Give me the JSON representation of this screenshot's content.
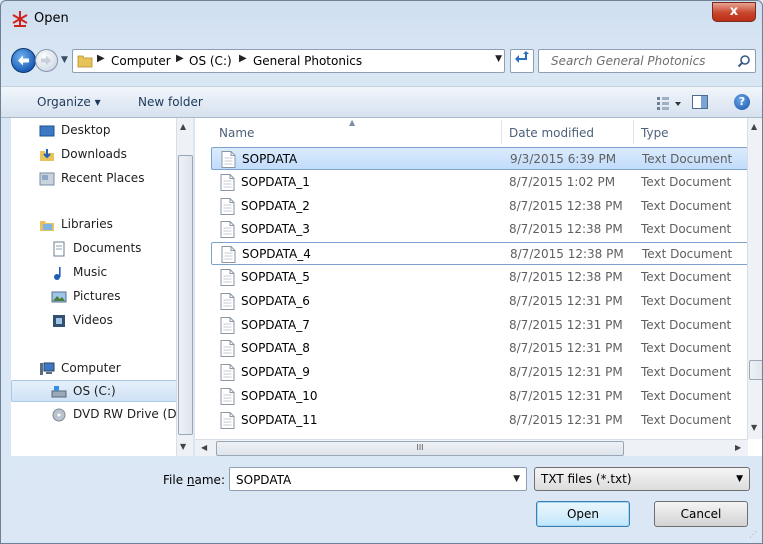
{
  "window": {
    "title": "Open",
    "close_label": "x"
  },
  "address": {
    "crumbs": [
      "Computer",
      "OS (C:)",
      "General Photonics"
    ],
    "search_placeholder": "Search General Photonics"
  },
  "toolbar": {
    "organize_label": "Organize ▾",
    "new_folder_label": "New folder"
  },
  "nav": {
    "items": [
      {
        "label": "Desktop",
        "icon": "desktop-icon"
      },
      {
        "label": "Downloads",
        "icon": "downloads-icon"
      },
      {
        "label": "Recent Places",
        "icon": "recent-places-icon"
      },
      {
        "label": "Libraries",
        "icon": "libraries-icon"
      },
      {
        "label": "Documents",
        "icon": "documents-icon"
      },
      {
        "label": "Music",
        "icon": "music-icon"
      },
      {
        "label": "Pictures",
        "icon": "pictures-icon"
      },
      {
        "label": "Videos",
        "icon": "videos-icon"
      },
      {
        "label": "Computer",
        "icon": "computer-icon"
      },
      {
        "label": "OS (C:)",
        "icon": "drive-icon"
      },
      {
        "label": "DVD RW Drive (D",
        "icon": "dvd-drive-icon"
      }
    ]
  },
  "files": {
    "columns": [
      "Name",
      "Date modified",
      "Type"
    ],
    "rows": [
      {
        "name": "SOPDATA",
        "date": "9/3/2015 6:39 PM",
        "type": "Text Document"
      },
      {
        "name": "SOPDATA_1",
        "date": "8/7/2015 1:02 PM",
        "type": "Text Document"
      },
      {
        "name": "SOPDATA_2",
        "date": "8/7/2015 12:38 PM",
        "type": "Text Document"
      },
      {
        "name": "SOPDATA_3",
        "date": "8/7/2015 12:38 PM",
        "type": "Text Document"
      },
      {
        "name": "SOPDATA_4",
        "date": "8/7/2015 12:38 PM",
        "type": "Text Document"
      },
      {
        "name": "SOPDATA_5",
        "date": "8/7/2015 12:38 PM",
        "type": "Text Document"
      },
      {
        "name": "SOPDATA_6",
        "date": "8/7/2015 12:31 PM",
        "type": "Text Document"
      },
      {
        "name": "SOPDATA_7",
        "date": "8/7/2015 12:31 PM",
        "type": "Text Document"
      },
      {
        "name": "SOPDATA_8",
        "date": "8/7/2015 12:31 PM",
        "type": "Text Document"
      },
      {
        "name": "SOPDATA_9",
        "date": "8/7/2015 12:31 PM",
        "type": "Text Document"
      },
      {
        "name": "SOPDATA_10",
        "date": "8/7/2015 12:31 PM",
        "type": "Text Document"
      },
      {
        "name": "SOPDATA_11",
        "date": "8/7/2015 12:31 PM",
        "type": "Text Document"
      }
    ]
  },
  "bottom": {
    "file_name_label_pre": "File ",
    "file_name_label_u": "n",
    "file_name_label_post": "ame:",
    "file_name_value": "SOPDATA",
    "file_type_value": "TXT files (*.txt)",
    "open_label": "Open",
    "cancel_label": "Cancel"
  }
}
